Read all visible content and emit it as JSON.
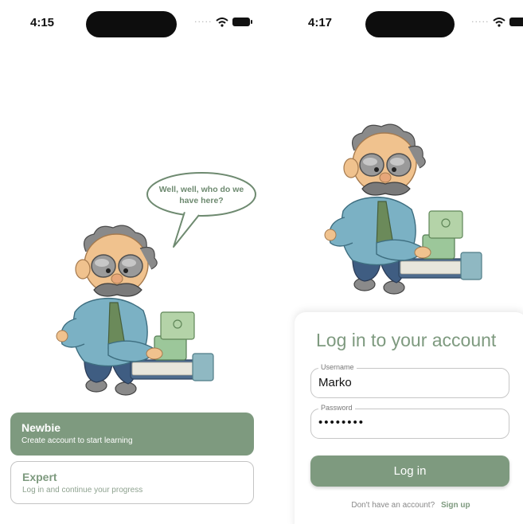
{
  "colors": {
    "accent": "#7e9a7f",
    "border": "#c4c4c4",
    "text_dark": "#111111"
  },
  "left_screen": {
    "status_bar": {
      "time": "4:15",
      "signal_icon": "cellular-dots-icon",
      "wifi_icon": "wifi-icon",
      "battery_icon": "battery-icon"
    },
    "speech_bubble": {
      "text": "Well, well, who do we have here?"
    },
    "illustration": "professor-with-books",
    "choices": [
      {
        "title": "Newbie",
        "subtitle": "Create account to start learning",
        "selected": true
      },
      {
        "title": "Expert",
        "subtitle": "Log in and continue your progress",
        "selected": false
      }
    ]
  },
  "right_screen": {
    "status_bar": {
      "time": "4:17",
      "signal_icon": "cellular-dots-icon",
      "wifi_icon": "wifi-icon",
      "battery_icon": "battery-icon"
    },
    "illustration": "professor-with-books",
    "login_card": {
      "title": "Log in to your account",
      "username": {
        "label": "Username",
        "value": "Marko"
      },
      "password": {
        "label": "Password",
        "value": "••••••••"
      },
      "submit_label": "Log in",
      "signup_prompt": "Don't have an account?",
      "signup_link": "Sign up"
    }
  }
}
